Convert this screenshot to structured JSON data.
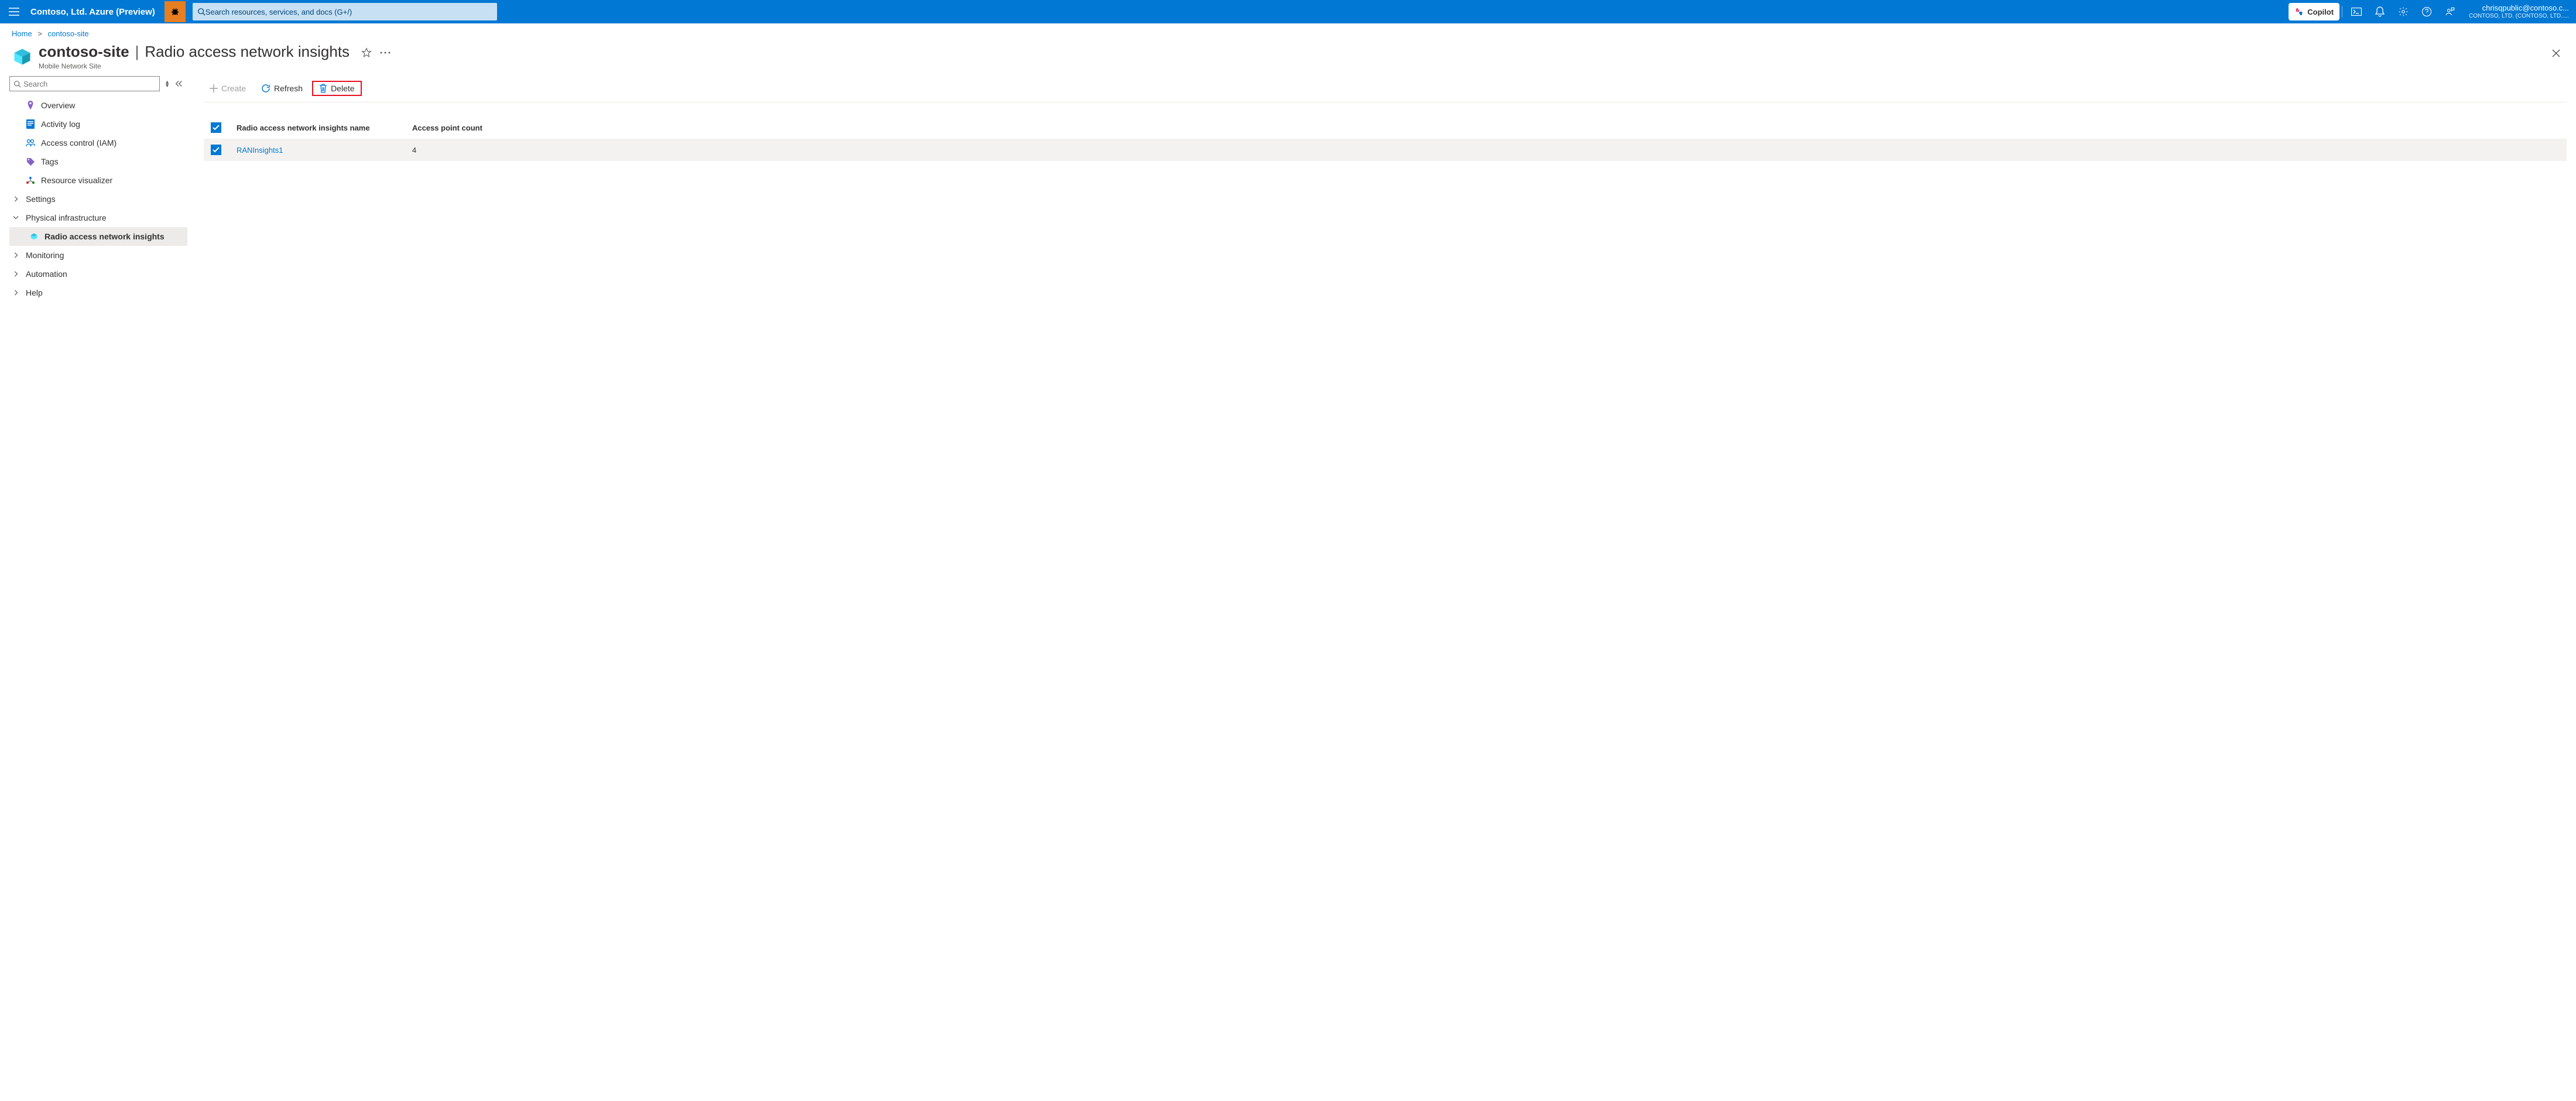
{
  "topbar": {
    "brand": "Contoso, Ltd. Azure (Preview)",
    "search_placeholder": "Search resources, services, and docs (G+/)",
    "copilot": "Copilot",
    "user_email": "chrisqpublic@contoso.c...",
    "user_tenant": "CONTOSO, LTD. (CONTOSO, LTD....."
  },
  "breadcrumb": {
    "home": "Home",
    "site": "contoso-site"
  },
  "header": {
    "resource": "contoso-site",
    "section": "Radio access network insights",
    "subtitle": "Mobile Network Site"
  },
  "sidebar": {
    "search_placeholder": "Search",
    "items": {
      "overview": "Overview",
      "activity": "Activity log",
      "iam": "Access control (IAM)",
      "tags": "Tags",
      "visualizer": "Resource visualizer",
      "settings": "Settings",
      "physical": "Physical infrastructure",
      "ran": "Radio access network insights",
      "monitoring": "Monitoring",
      "automation": "Automation",
      "help": "Help"
    }
  },
  "toolbar": {
    "create": "Create",
    "refresh": "Refresh",
    "delete": "Delete"
  },
  "grid": {
    "col_name": "Radio access network insights name",
    "col_count": "Access point count",
    "rows": [
      {
        "name": "RANInsights1",
        "count": "4"
      }
    ]
  }
}
